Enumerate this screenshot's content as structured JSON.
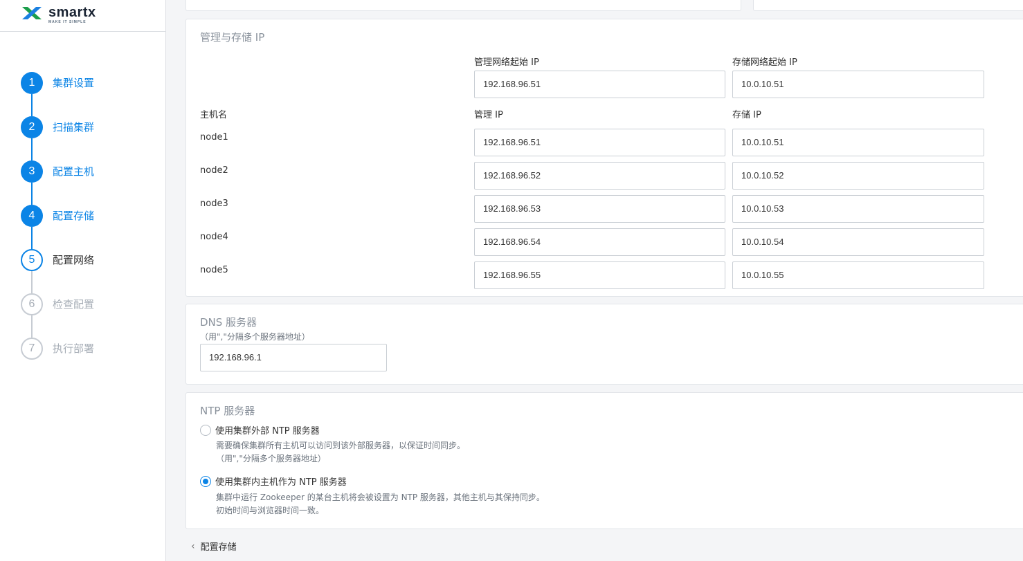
{
  "brand": {
    "name": "smartx",
    "tagline": "MAKE IT SIMPLE"
  },
  "steps": [
    {
      "num": "1",
      "label": "集群设置",
      "state": "done"
    },
    {
      "num": "2",
      "label": "扫描集群",
      "state": "done"
    },
    {
      "num": "3",
      "label": "配置主机",
      "state": "done"
    },
    {
      "num": "4",
      "label": "配置存储",
      "state": "done"
    },
    {
      "num": "5",
      "label": "配置网络",
      "state": "current"
    },
    {
      "num": "6",
      "label": "检查配置",
      "state": "todo"
    },
    {
      "num": "7",
      "label": "执行部署",
      "state": "todo"
    }
  ],
  "mgmt_storage": {
    "title": "管理与存储 IP",
    "mgmt_start_label": "管理网络起始 IP",
    "storage_start_label": "存储网络起始 IP",
    "mgmt_start_value": "192.168.96.51",
    "storage_start_value": "10.0.10.51",
    "hostname_header": "主机名",
    "mgmt_ip_header": "管理 IP",
    "storage_ip_header": "存储 IP",
    "rows": [
      {
        "host": "node1",
        "mgmt": "192.168.96.51",
        "storage": "10.0.10.51"
      },
      {
        "host": "node2",
        "mgmt": "192.168.96.52",
        "storage": "10.0.10.52"
      },
      {
        "host": "node3",
        "mgmt": "192.168.96.53",
        "storage": "10.0.10.53"
      },
      {
        "host": "node4",
        "mgmt": "192.168.96.54",
        "storage": "10.0.10.54"
      },
      {
        "host": "node5",
        "mgmt": "192.168.96.55",
        "storage": "10.0.10.55"
      }
    ]
  },
  "dns": {
    "title": "DNS 服务器",
    "hint": "（用\",\"分隔多个服务器地址）",
    "value": "192.168.96.1"
  },
  "ntp": {
    "title": "NTP 服务器",
    "option_external": {
      "label": "使用集群外部 NTP 服务器",
      "selected": false,
      "desc1": "需要确保集群所有主机可以访问到该外部服务器，以保证时间同步。",
      "desc2": "（用\",\"分隔多个服务器地址）"
    },
    "option_internal": {
      "label": "使用集群内主机作为 NTP 服务器",
      "selected": true,
      "desc1": "集群中运行 Zookeeper 的某台主机将会被设置为 NTP 服务器，其他主机与其保持同步。",
      "desc2": "初始时间与浏览器时间一致。"
    }
  },
  "footer": {
    "back_label": "配置存储"
  },
  "colors": {
    "accent": "#0b84e6",
    "inactive": "#c7ccd3",
    "border": "#e2e5e9"
  }
}
